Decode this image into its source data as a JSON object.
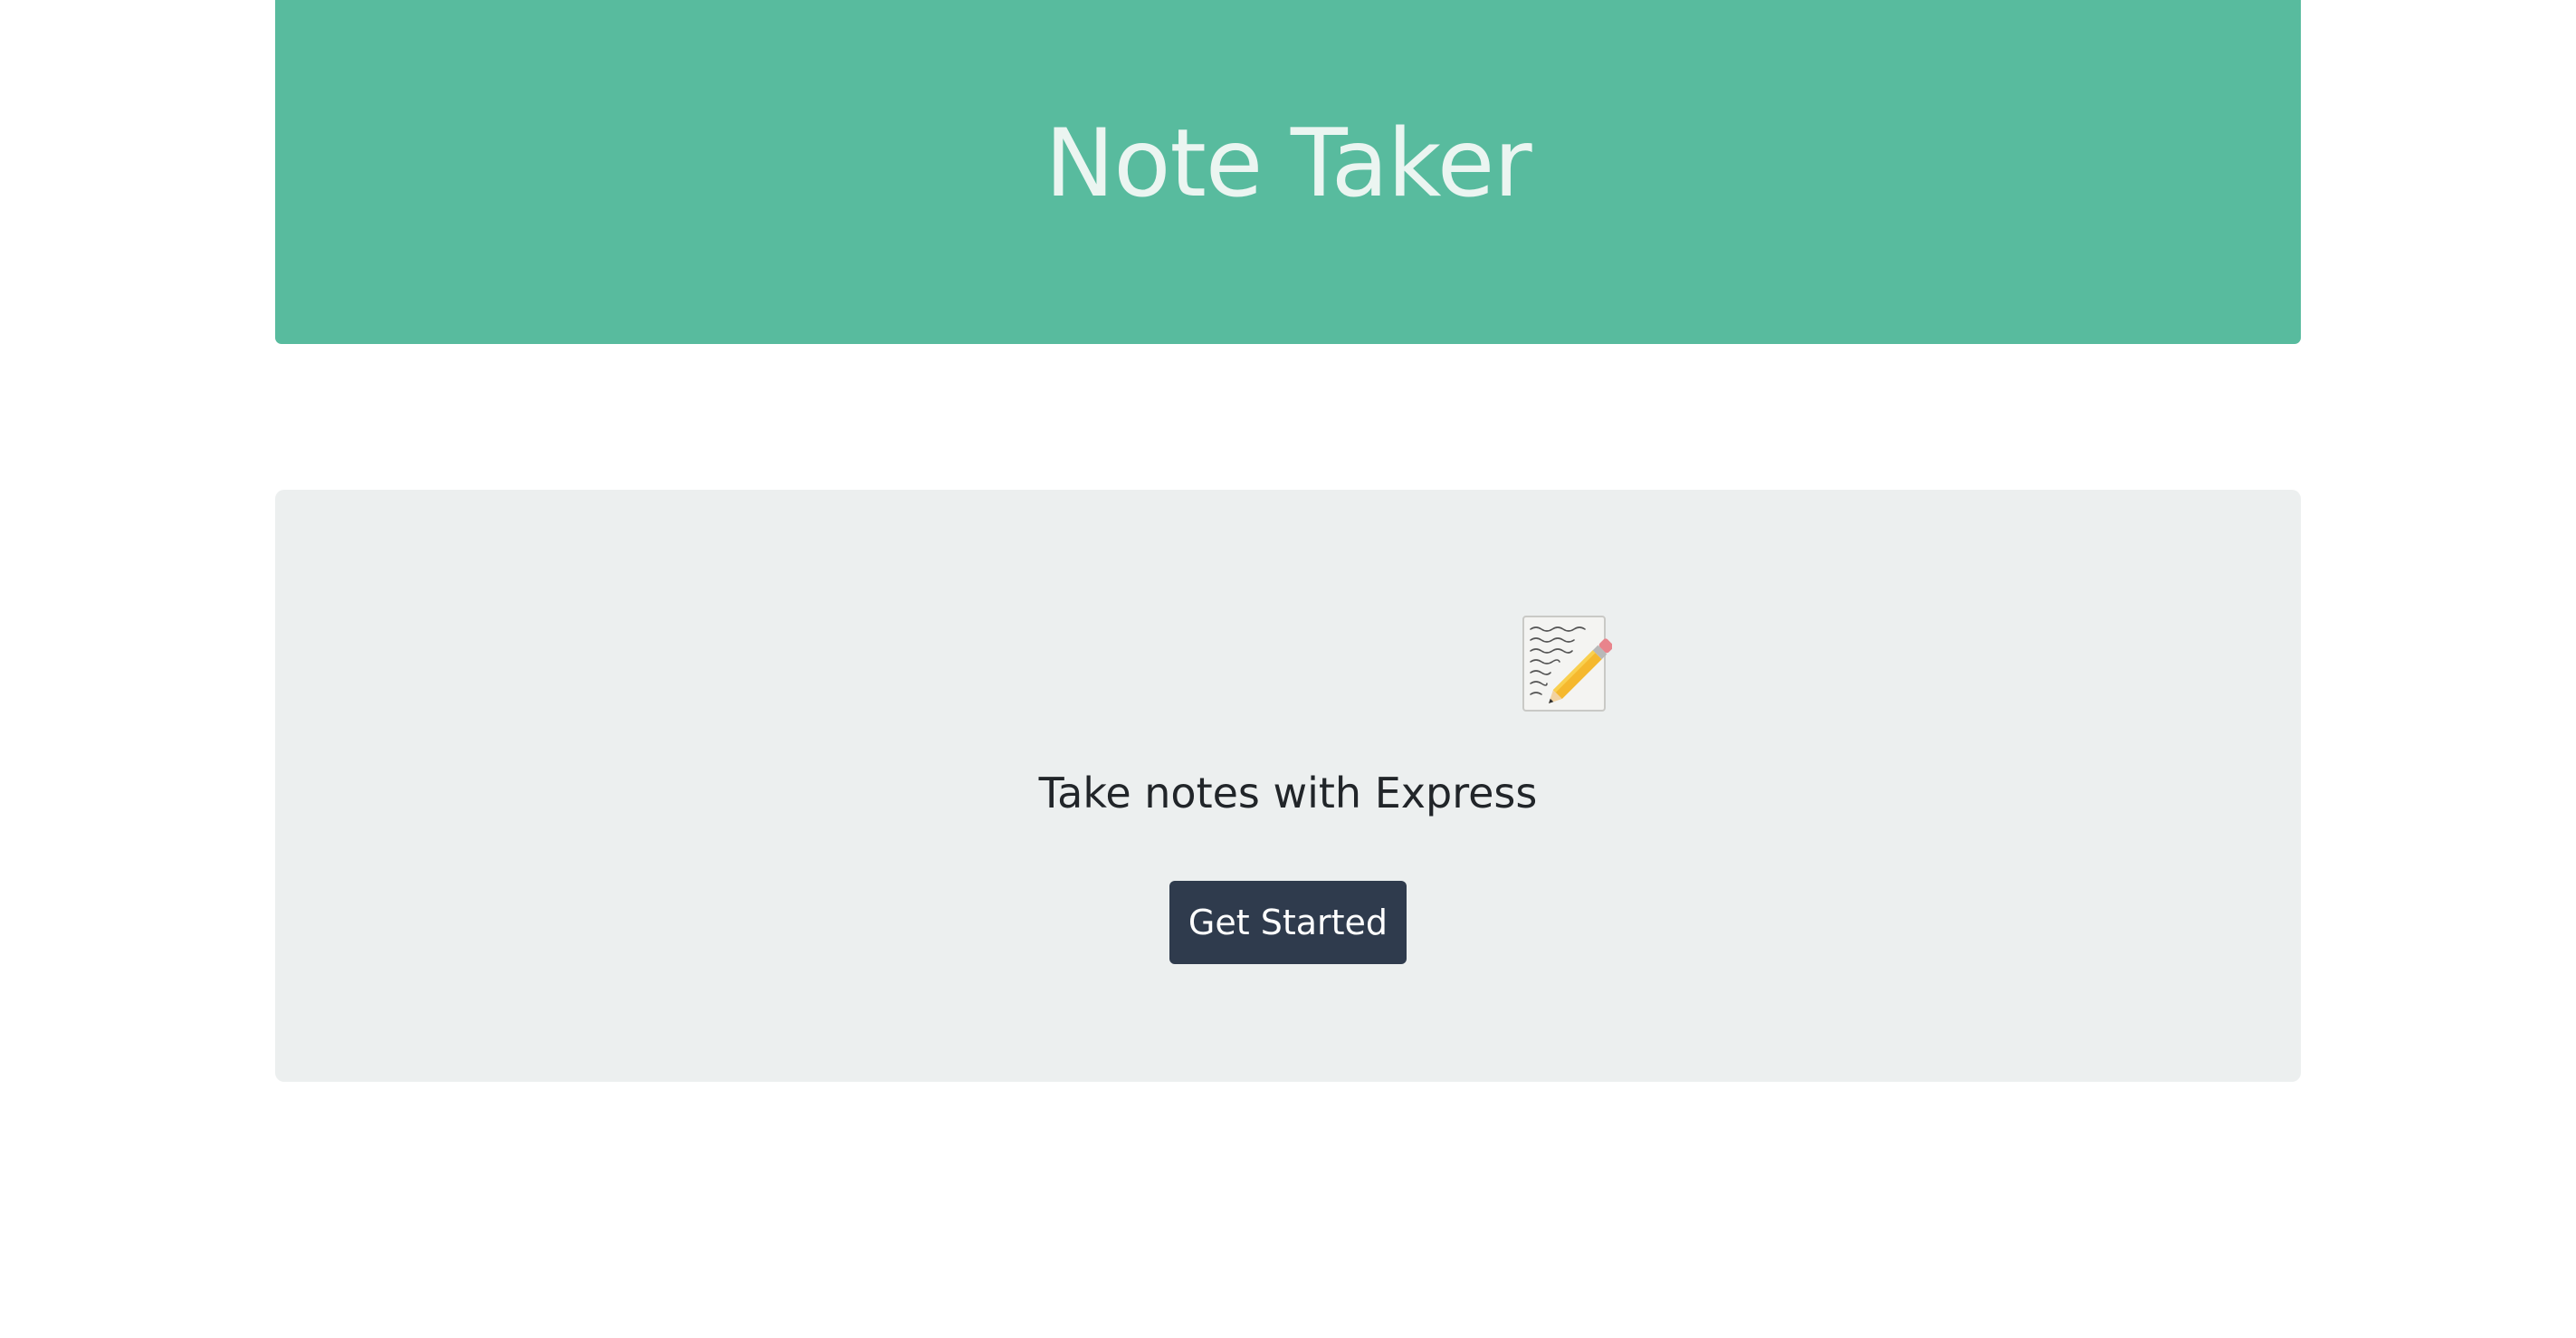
{
  "header": {
    "title": "Note Taker"
  },
  "hero": {
    "icon": "memo-pencil-icon",
    "tagline": "Take notes with Express",
    "cta_label": "Get Started"
  },
  "colors": {
    "header_bg": "#58bb9e",
    "header_text": "#ebf5f1",
    "hero_bg": "#ecefef",
    "button_bg": "#2f3b4d",
    "button_text": "#ffffff"
  }
}
